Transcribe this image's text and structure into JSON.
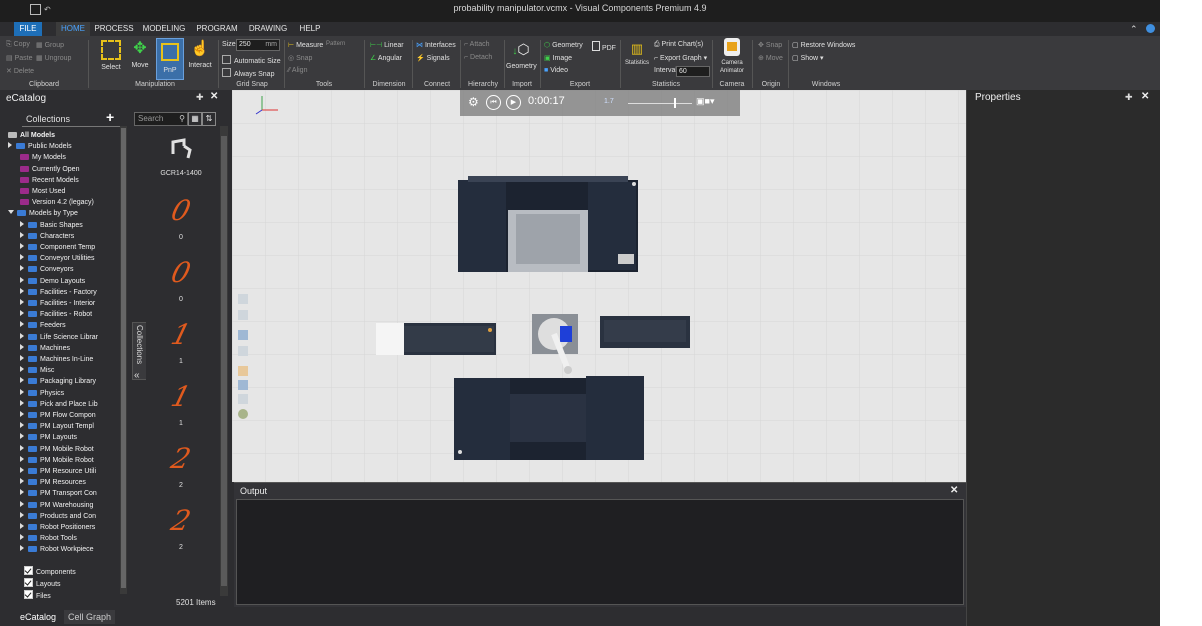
{
  "window": {
    "title": "probability manipulator.vcmx - Visual Components Premium 4.9"
  },
  "menu": {
    "file": "FILE",
    "home": "HOME",
    "process": "PROCESS",
    "modeling": "MODELING",
    "program": "PROGRAM",
    "drawing": "DRAWING",
    "help": "HELP"
  },
  "ribbon": {
    "clipboard": {
      "copy": "Copy",
      "paste": "Paste",
      "delete": "Delete",
      "group": "Group",
      "ungroup": "Ungroup",
      "label": "Clipboard"
    },
    "manipulation": {
      "select": "Select",
      "move": "Move",
      "pnp": "PnP",
      "interact": "Interact",
      "label": "Manipulation"
    },
    "gridsnap": {
      "size_label": "Size",
      "size_value": "250",
      "size_unit": "mm",
      "automatic": "Automatic Size",
      "always": "Always Snap",
      "label": "Grid Snap"
    },
    "tools": {
      "measure": "Measure",
      "pattern": "Pattern",
      "snap": "Snap",
      "align": "Align",
      "label": "Tools"
    },
    "dimension": {
      "linear": "Linear",
      "angular": "Angular",
      "label": "Dimension"
    },
    "connect": {
      "interfaces": "Interfaces",
      "signals": "Signals",
      "label": "Connect"
    },
    "hierarchy": {
      "attach": "Attach",
      "detach": "Detach",
      "label": "Hierarchy"
    },
    "import": {
      "geometry": "Geometry",
      "label": "Import"
    },
    "export": {
      "geometry": "Geometry",
      "pdf": "PDF",
      "image": "Image",
      "video": "Video",
      "label": "Export"
    },
    "statistics": {
      "statistics": "Statistics",
      "print_charts": "Print Chart(s)",
      "export_graph": "Export Graph",
      "interval_label": "Interval",
      "interval_value": "60",
      "label": "Statistics"
    },
    "camera": {
      "animator": "Camera Animator",
      "label": "Camera"
    },
    "origin": {
      "snap": "Snap",
      "move": "Move",
      "label": "Origin"
    },
    "windows": {
      "restore": "Restore Windows",
      "show": "Show",
      "label": "Windows"
    }
  },
  "ecatalog": {
    "title": "eCatalog",
    "collections_label": "Collections",
    "search_placeholder": "Search",
    "side_tab": "Collections",
    "items_count": "5201 Items",
    "tree": [
      {
        "label": "All Models",
        "bold": true
      },
      {
        "label": "Public Models"
      },
      {
        "label": "My Models"
      },
      {
        "label": "Currently Open"
      },
      {
        "label": "Recent Models"
      },
      {
        "label": "Most Used"
      },
      {
        "label": "Version 4.2 (legacy)"
      },
      {
        "label": "Models by Type"
      },
      {
        "label": "Basic Shapes"
      },
      {
        "label": "Characters"
      },
      {
        "label": "Component Temp"
      },
      {
        "label": "Conveyor Utilities"
      },
      {
        "label": "Conveyors"
      },
      {
        "label": "Demo Layouts"
      },
      {
        "label": "Facilities - Factory"
      },
      {
        "label": "Facilities - Interior"
      },
      {
        "label": "Facilities - Robot"
      },
      {
        "label": "Feeders"
      },
      {
        "label": "Life Science Librar"
      },
      {
        "label": "Machines"
      },
      {
        "label": "Machines In-Line"
      },
      {
        "label": "Misc"
      },
      {
        "label": "Packaging Library"
      },
      {
        "label": "Physics"
      },
      {
        "label": "Pick and Place Lib"
      },
      {
        "label": "PM Flow Compon"
      },
      {
        "label": "PM Layout Templ"
      },
      {
        "label": "PM Layouts"
      },
      {
        "label": "PM Mobile Robot"
      },
      {
        "label": "PM Mobile Robot"
      },
      {
        "label": "PM Resource Utili"
      },
      {
        "label": "PM Resources"
      },
      {
        "label": "PM Transport Con"
      },
      {
        "label": "PM Warehousing"
      },
      {
        "label": "Products and Con"
      },
      {
        "label": "Robot Positioners"
      },
      {
        "label": "Robot Tools"
      },
      {
        "label": "Robot Workpiece"
      }
    ],
    "filters": [
      {
        "label": "Components"
      },
      {
        "label": "Layouts"
      },
      {
        "label": "Files"
      }
    ],
    "models": [
      {
        "label": "GCR14-1400"
      },
      {
        "label": "0",
        "glyph": "0"
      },
      {
        "label": "0",
        "glyph": "0"
      },
      {
        "label": "1",
        "glyph": "1"
      },
      {
        "label": "1",
        "glyph": "1"
      },
      {
        "label": "2",
        "glyph": "2"
      },
      {
        "label": "2",
        "glyph": "2"
      }
    ],
    "bottom_tabs": {
      "ecatalog": "eCatalog",
      "cellgraph": "Cell Graph"
    }
  },
  "viewport": {
    "sim_time": "0:00:17",
    "speed": "1.7"
  },
  "output": {
    "title": "Output"
  },
  "properties": {
    "title": "Properties"
  },
  "colors": {
    "accent": "#1e6fb8",
    "orange_glyph": "#e05a1e",
    "folder_purple": "#9b2b8a",
    "folder_blue": "#3a7bd5"
  }
}
